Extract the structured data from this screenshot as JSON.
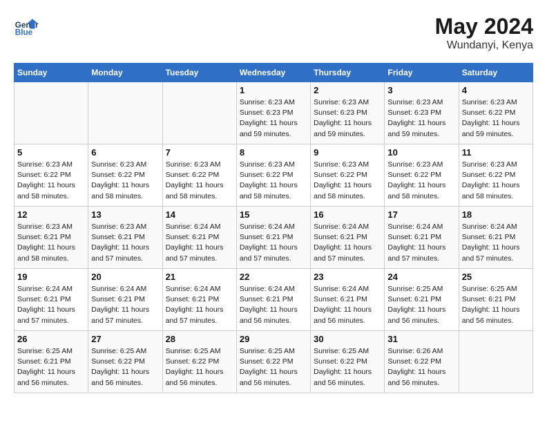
{
  "header": {
    "logo_line1": "General",
    "logo_line2": "Blue",
    "month_year": "May 2024",
    "location": "Wundanyi, Kenya"
  },
  "weekdays": [
    "Sunday",
    "Monday",
    "Tuesday",
    "Wednesday",
    "Thursday",
    "Friday",
    "Saturday"
  ],
  "weeks": [
    [
      null,
      null,
      null,
      {
        "day": "1",
        "sunrise": "6:23 AM",
        "sunset": "6:23 PM",
        "daylight": "11 hours and 59 minutes."
      },
      {
        "day": "2",
        "sunrise": "6:23 AM",
        "sunset": "6:23 PM",
        "daylight": "11 hours and 59 minutes."
      },
      {
        "day": "3",
        "sunrise": "6:23 AM",
        "sunset": "6:23 PM",
        "daylight": "11 hours and 59 minutes."
      },
      {
        "day": "4",
        "sunrise": "6:23 AM",
        "sunset": "6:22 PM",
        "daylight": "11 hours and 59 minutes."
      }
    ],
    [
      {
        "day": "5",
        "sunrise": "6:23 AM",
        "sunset": "6:22 PM",
        "daylight": "11 hours and 58 minutes."
      },
      {
        "day": "6",
        "sunrise": "6:23 AM",
        "sunset": "6:22 PM",
        "daylight": "11 hours and 58 minutes."
      },
      {
        "day": "7",
        "sunrise": "6:23 AM",
        "sunset": "6:22 PM",
        "daylight": "11 hours and 58 minutes."
      },
      {
        "day": "8",
        "sunrise": "6:23 AM",
        "sunset": "6:22 PM",
        "daylight": "11 hours and 58 minutes."
      },
      {
        "day": "9",
        "sunrise": "6:23 AM",
        "sunset": "6:22 PM",
        "daylight": "11 hours and 58 minutes."
      },
      {
        "day": "10",
        "sunrise": "6:23 AM",
        "sunset": "6:22 PM",
        "daylight": "11 hours and 58 minutes."
      },
      {
        "day": "11",
        "sunrise": "6:23 AM",
        "sunset": "6:22 PM",
        "daylight": "11 hours and 58 minutes."
      }
    ],
    [
      {
        "day": "12",
        "sunrise": "6:23 AM",
        "sunset": "6:21 PM",
        "daylight": "11 hours and 58 minutes."
      },
      {
        "day": "13",
        "sunrise": "6:23 AM",
        "sunset": "6:21 PM",
        "daylight": "11 hours and 57 minutes."
      },
      {
        "day": "14",
        "sunrise": "6:24 AM",
        "sunset": "6:21 PM",
        "daylight": "11 hours and 57 minutes."
      },
      {
        "day": "15",
        "sunrise": "6:24 AM",
        "sunset": "6:21 PM",
        "daylight": "11 hours and 57 minutes."
      },
      {
        "day": "16",
        "sunrise": "6:24 AM",
        "sunset": "6:21 PM",
        "daylight": "11 hours and 57 minutes."
      },
      {
        "day": "17",
        "sunrise": "6:24 AM",
        "sunset": "6:21 PM",
        "daylight": "11 hours and 57 minutes."
      },
      {
        "day": "18",
        "sunrise": "6:24 AM",
        "sunset": "6:21 PM",
        "daylight": "11 hours and 57 minutes."
      }
    ],
    [
      {
        "day": "19",
        "sunrise": "6:24 AM",
        "sunset": "6:21 PM",
        "daylight": "11 hours and 57 minutes."
      },
      {
        "day": "20",
        "sunrise": "6:24 AM",
        "sunset": "6:21 PM",
        "daylight": "11 hours and 57 minutes."
      },
      {
        "day": "21",
        "sunrise": "6:24 AM",
        "sunset": "6:21 PM",
        "daylight": "11 hours and 57 minutes."
      },
      {
        "day": "22",
        "sunrise": "6:24 AM",
        "sunset": "6:21 PM",
        "daylight": "11 hours and 56 minutes."
      },
      {
        "day": "23",
        "sunrise": "6:24 AM",
        "sunset": "6:21 PM",
        "daylight": "11 hours and 56 minutes."
      },
      {
        "day": "24",
        "sunrise": "6:25 AM",
        "sunset": "6:21 PM",
        "daylight": "11 hours and 56 minutes."
      },
      {
        "day": "25",
        "sunrise": "6:25 AM",
        "sunset": "6:21 PM",
        "daylight": "11 hours and 56 minutes."
      }
    ],
    [
      {
        "day": "26",
        "sunrise": "6:25 AM",
        "sunset": "6:21 PM",
        "daylight": "11 hours and 56 minutes."
      },
      {
        "day": "27",
        "sunrise": "6:25 AM",
        "sunset": "6:22 PM",
        "daylight": "11 hours and 56 minutes."
      },
      {
        "day": "28",
        "sunrise": "6:25 AM",
        "sunset": "6:22 PM",
        "daylight": "11 hours and 56 minutes."
      },
      {
        "day": "29",
        "sunrise": "6:25 AM",
        "sunset": "6:22 PM",
        "daylight": "11 hours and 56 minutes."
      },
      {
        "day": "30",
        "sunrise": "6:25 AM",
        "sunset": "6:22 PM",
        "daylight": "11 hours and 56 minutes."
      },
      {
        "day": "31",
        "sunrise": "6:26 AM",
        "sunset": "6:22 PM",
        "daylight": "11 hours and 56 minutes."
      },
      null
    ]
  ]
}
